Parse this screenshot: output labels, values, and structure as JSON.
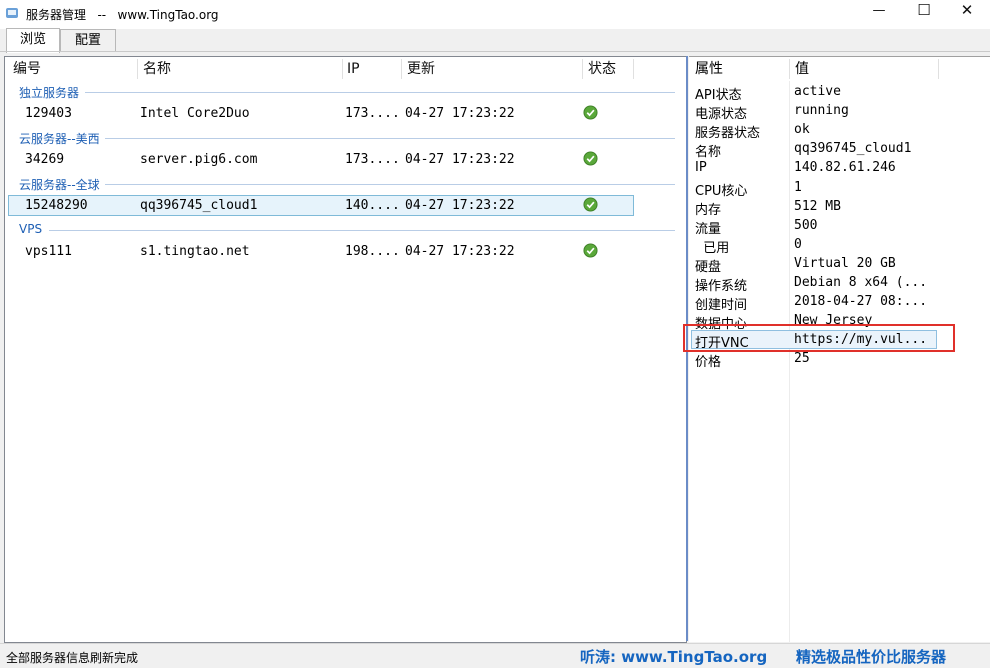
{
  "window": {
    "title": "服务器管理   --   www.TingTao.org",
    "minimize_glyph": "—",
    "maximize_glyph": "☐",
    "close_glyph": "✕"
  },
  "tabs": [
    {
      "label": "浏览",
      "active": true
    },
    {
      "label": "配置",
      "active": false
    }
  ],
  "server_list": {
    "columns": [
      "编号",
      "名称",
      "IP",
      "更新",
      "状态"
    ],
    "groups": [
      {
        "label": "独立服务器",
        "rows": [
          {
            "id": "129403",
            "name": "Intel Core2Duo",
            "ip": "173....",
            "updated": "04-27 17:23:22",
            "status": "check-ok-icon"
          }
        ]
      },
      {
        "label": "云服务器--美西",
        "rows": [
          {
            "id": "34269",
            "name": "server.pig6.com",
            "ip": "173....",
            "updated": "04-27 17:23:22",
            "status": "check-ok-icon"
          }
        ]
      },
      {
        "label": "云服务器--全球",
        "rows": [
          {
            "id": "15248290",
            "name": "qq396745_cloud1",
            "ip": "140....",
            "updated": "04-27 17:23:22",
            "status": "check-ok-icon",
            "selected": true
          }
        ]
      },
      {
        "label": "VPS",
        "rows": [
          {
            "id": "vps111",
            "name": "s1.tingtao.net",
            "ip": "198....",
            "updated": "04-27 17:23:22",
            "status": "check-ok-icon"
          }
        ]
      }
    ]
  },
  "properties": {
    "columns": [
      "属性",
      "值"
    ],
    "rows": [
      {
        "name": "API状态",
        "value": "active"
      },
      {
        "name": "电源状态",
        "value": "running"
      },
      {
        "name": "服务器状态",
        "value": "ok"
      },
      {
        "name": "名称",
        "value": "qq396745_cloud1"
      },
      {
        "name": "IP",
        "value": "140.82.61.246"
      },
      {
        "name": "CPU核心",
        "value": "1"
      },
      {
        "name": "内存",
        "value": "512 MB"
      },
      {
        "name": "流量",
        "value": "500"
      },
      {
        "name": "  已用",
        "value": "0"
      },
      {
        "name": "硬盘",
        "value": "Virtual 20 GB"
      },
      {
        "name": "操作系统",
        "value": "Debian 8 x64 (..."
      },
      {
        "name": "创建时间",
        "value": "2018-04-27 08:..."
      },
      {
        "name": "数据中心",
        "value": "New Jersey"
      },
      {
        "name": "打开VNC",
        "value": "https://my.vul...",
        "highlighted": true
      },
      {
        "name": "价格",
        "value": "25"
      }
    ]
  },
  "statusbar": {
    "message": "全部服务器信息刷新完成",
    "promo_site": "听涛: www.TingTao.org",
    "promo_slogan": "精选极品性价比服务器"
  },
  "colors": {
    "accent": "#1565c0",
    "group_label": "#1e5fb4",
    "selection_bg": "#e6f3fb",
    "selection_border": "#7fbad8",
    "highlight_box": "#e0302a",
    "check_green": "#5aa83a"
  }
}
